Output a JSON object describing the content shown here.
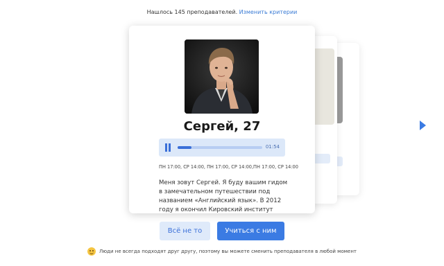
{
  "header": {
    "found_text": "Нашлось 145 преподавателей.",
    "change_criteria_link": "Изменить критерии"
  },
  "teacher": {
    "name_age": "Сергей, 27",
    "audio": {
      "time": "01:54",
      "progress": 0.16,
      "state": "playing"
    },
    "schedule": "ПН 17:00, СР 14:00, ПН 17:00, СР 14:00,ПН 17:00, СР 14:00",
    "description": "Меня зовут Сергей. Я буду вашим гидом в замечательном путешествии под названием «Английский язык». В 2012 году я окончил Кировский институт"
  },
  "actions": {
    "reject_label": "Всё не то",
    "accept_label": "Учиться с ним"
  },
  "footer": {
    "note": "Люди не всегда подходят друг другу, поэтому вы можете сменить преподавателя в любой момент"
  },
  "colors": {
    "accent": "#3b7be3",
    "accent_light": "#dfeafa",
    "link": "#3a7bd5"
  },
  "icons": [
    "pause-icon",
    "next-arrow-icon",
    "smile-emoji-icon"
  ]
}
